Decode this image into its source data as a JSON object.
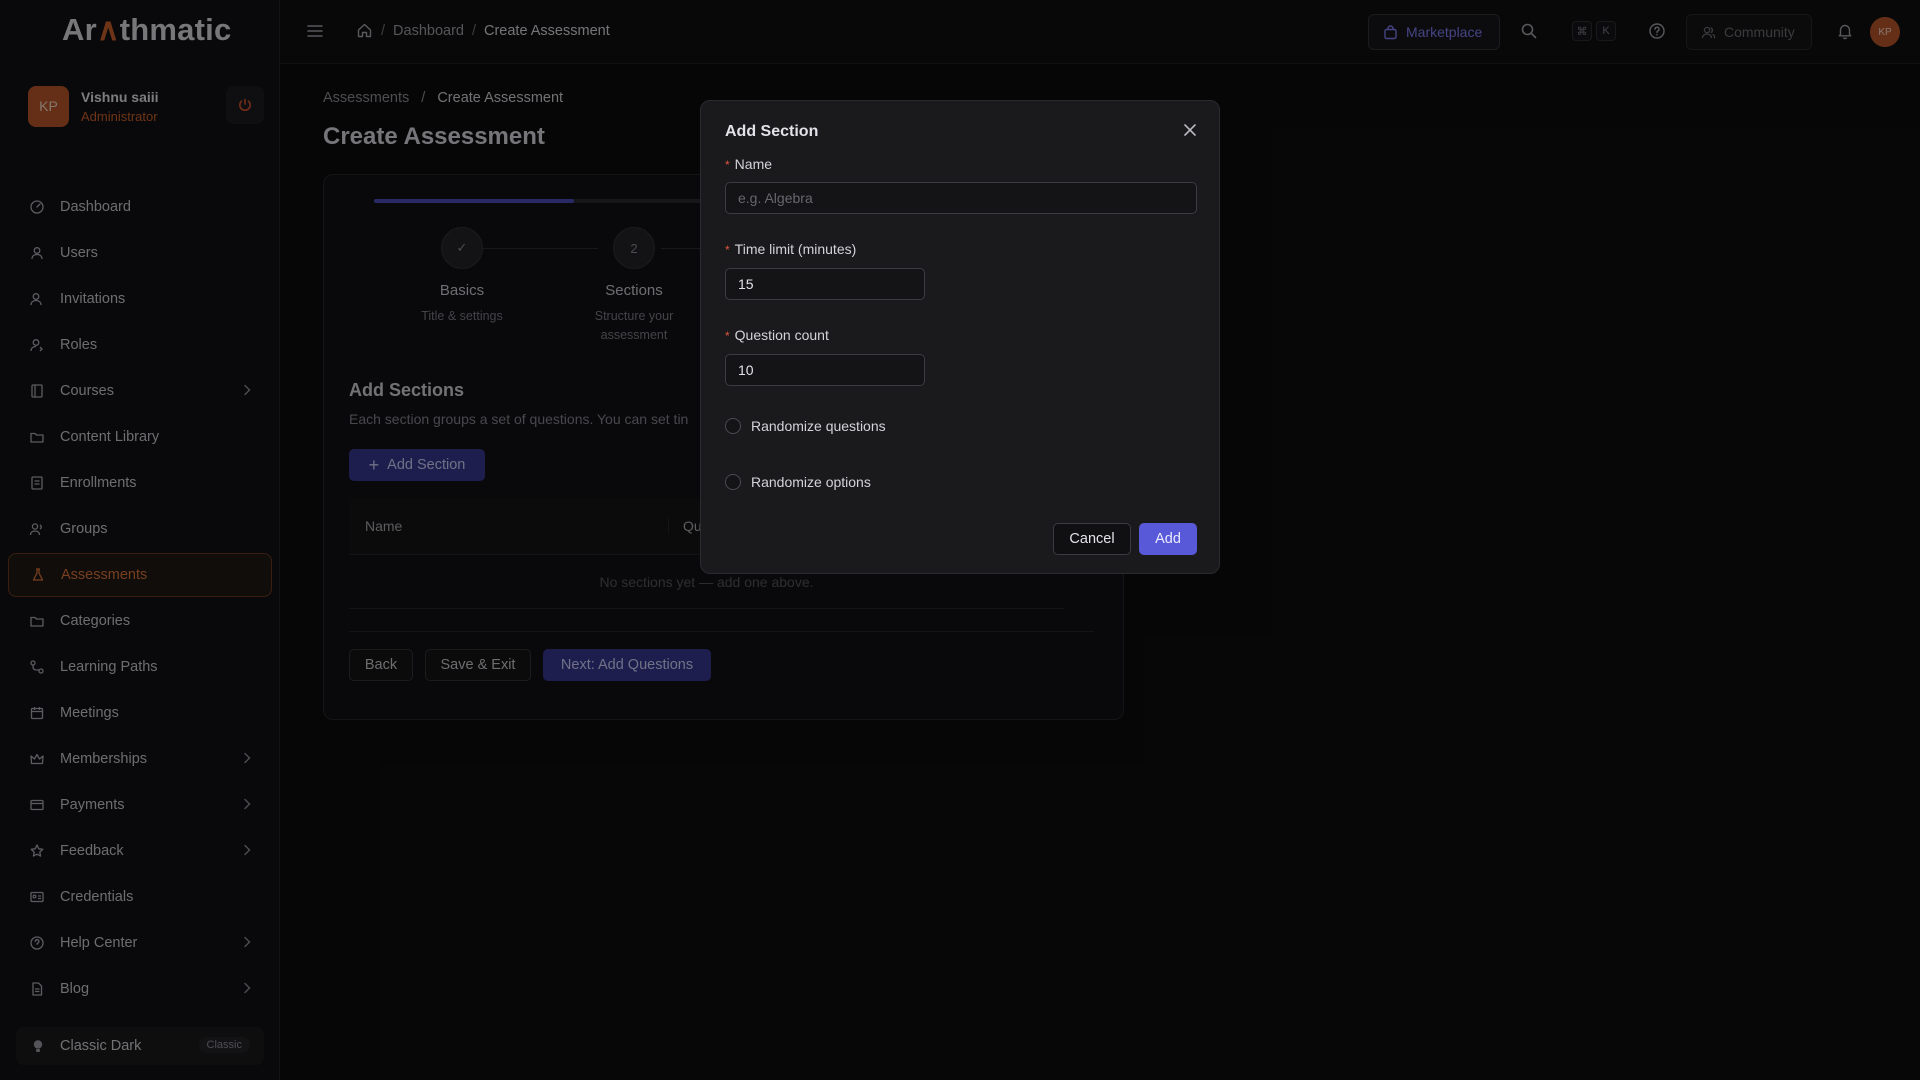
{
  "app": {
    "logo_prefix": "Ar",
    "logo_accent": "∧",
    "logo_suffix": "thmatic"
  },
  "user": {
    "initials": "KP",
    "name": "Vishnu saiii",
    "role": "Administrator"
  },
  "sidebar": {
    "items": [
      {
        "label": "Dashboard",
        "icon": "dashboard-icon",
        "chevron": false
      },
      {
        "label": "Users",
        "icon": "user-icon",
        "chevron": false
      },
      {
        "label": "Invitations",
        "icon": "user-plus-icon",
        "chevron": false
      },
      {
        "label": "Roles",
        "icon": "roles-icon",
        "chevron": false
      },
      {
        "label": "Courses",
        "icon": "book-icon",
        "chevron": true
      },
      {
        "label": "Content Library",
        "icon": "folder-icon",
        "chevron": false
      },
      {
        "label": "Enrollments",
        "icon": "enrollment-icon",
        "chevron": false
      },
      {
        "label": "Groups",
        "icon": "group-icon",
        "chevron": false
      },
      {
        "label": "Assessments",
        "icon": "flask-icon",
        "chevron": false,
        "active": true
      },
      {
        "label": "Categories",
        "icon": "folder-icon",
        "chevron": false
      },
      {
        "label": "Learning Paths",
        "icon": "path-icon",
        "chevron": false
      },
      {
        "label": "Meetings",
        "icon": "calendar-icon",
        "chevron": false
      },
      {
        "label": "Memberships",
        "icon": "crown-icon",
        "chevron": true
      },
      {
        "label": "Payments",
        "icon": "credit-card-icon",
        "chevron": true
      },
      {
        "label": "Feedback",
        "icon": "star-icon",
        "chevron": true
      },
      {
        "label": "Credentials",
        "icon": "id-card-icon",
        "chevron": false
      },
      {
        "label": "Help Center",
        "icon": "help-circle-icon",
        "chevron": true
      },
      {
        "label": "Blog",
        "icon": "document-icon",
        "chevron": true
      }
    ],
    "theme_label": "Classic Dark",
    "theme_badge": "Classic"
  },
  "topbar": {
    "breadcrumb": [
      "Dashboard",
      "Create Assessment"
    ],
    "marketplace": "Marketplace",
    "kbd_cmd": "⌘",
    "kbd_k": "K",
    "community": "Community",
    "avatar_initials": "KP"
  },
  "main": {
    "breadcrumb_parent": "Assessments",
    "breadcrumb_current": "Create Assessment",
    "title": "Create Assessment",
    "progress_fraction": 0.286,
    "steps": [
      {
        "marker": "✓",
        "title": "Basics",
        "sub": "Title & settings"
      },
      {
        "marker": "2",
        "title": "Sections",
        "sub": "Structure your assessment"
      }
    ],
    "section_heading": "Add Sections",
    "section_desc": "Each section groups a set of questions. You can set tin",
    "add_section_label": "Add Section",
    "table_headers": [
      "Name",
      "Qu"
    ],
    "empty_text": "No sections yet — add one above.",
    "back_label": "Back",
    "save_exit_label": "Save & Exit",
    "next_label": "Next: Add Questions"
  },
  "modal": {
    "title": "Add Section",
    "name_label": "Name",
    "name_placeholder": "e.g. Algebra",
    "time_label": "Time limit (minutes)",
    "time_value": "15",
    "count_label": "Question count",
    "count_value": "10",
    "randomize_questions": "Randomize questions",
    "randomize_options": "Randomize options",
    "cancel_label": "Cancel",
    "add_label": "Add",
    "required_mark": "*"
  },
  "colors": {
    "accent_orange": "#c9602a",
    "primary_indigo": "#5859d8"
  }
}
